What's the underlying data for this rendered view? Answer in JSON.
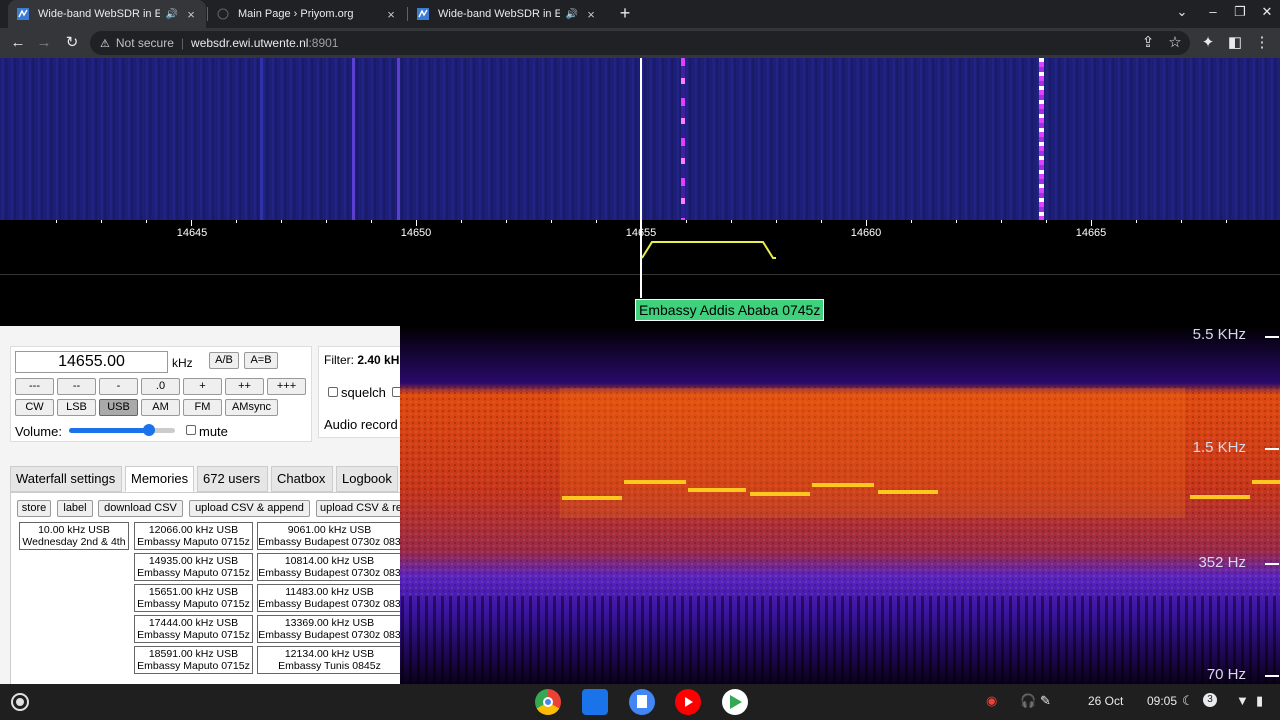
{
  "browser": {
    "tabs": [
      {
        "title": "Wide-band WebSDR in Ensch",
        "audio": true,
        "active": true
      },
      {
        "title": "Main Page › Priyom.org",
        "audio": false,
        "active": false
      },
      {
        "title": "Wide-band WebSDR in Ensch",
        "audio": true,
        "active": false
      }
    ],
    "new_tab": "+",
    "address": {
      "security": "Not secure",
      "host": "websdr.ewi.utwente.nl",
      "port": ":8901"
    }
  },
  "scale": {
    "ticks": [
      "14645",
      "14650",
      "14655",
      "14660",
      "14665"
    ]
  },
  "station_label": "Embassy Addis Ababa 0745z",
  "spectrogram": {
    "labels": [
      "5.5 KHz",
      "1.5 KHz",
      "352 Hz",
      "70 Hz"
    ]
  },
  "tuning": {
    "frequency": "14655.00",
    "unit": "kHz",
    "ab_buttons": [
      "A/B",
      "A=B"
    ],
    "step_buttons": [
      "---",
      "--",
      "-",
      ".0",
      "+",
      "++",
      "+++"
    ],
    "modes": [
      "CW",
      "LSB",
      "USB",
      "AM",
      "FM",
      "AMsync"
    ],
    "selected_mode": "USB",
    "volume_label": "Volume:",
    "volume_level": 0.75,
    "mute_label": "mute"
  },
  "filter": {
    "label": "Filter:",
    "value": "2.40 kH",
    "squelch_label": "squelch",
    "audio_label": "Audio record"
  },
  "panel_tabs": [
    "Waterfall settings",
    "Memories",
    "672 users",
    "Chatbox",
    "Logbook"
  ],
  "active_panel_tab": "Memories",
  "memories": {
    "buttons": [
      "store",
      "label",
      "download CSV",
      "upload CSV & append",
      "upload CSV & re"
    ],
    "columns": [
      [
        {
          "freq": "10.00 kHz USB",
          "name": "Wednesday 2nd & 4th"
        }
      ],
      [
        {
          "freq": "12066.00 kHz USB",
          "name": "Embassy Maputo 0715z"
        },
        {
          "freq": "14935.00 kHz USB",
          "name": "Embassy Maputo 0715z"
        },
        {
          "freq": "15651.00 kHz USB",
          "name": "Embassy Maputo 0715z"
        },
        {
          "freq": "17444.00 kHz USB",
          "name": "Embassy Maputo 0715z"
        },
        {
          "freq": "18591.00 kHz USB",
          "name": "Embassy Maputo 0715z"
        }
      ],
      [
        {
          "freq": "9061.00 kHz USB",
          "name": "Embassy Budapest 0730z 083"
        },
        {
          "freq": "10814.00 kHz USB",
          "name": "Embassy Budapest 0730z 083"
        },
        {
          "freq": "11483.00 kHz USB",
          "name": "Embassy Budapest 0730z 083"
        },
        {
          "freq": "13369.00 kHz USB",
          "name": "Embassy Budapest 0730z 083"
        },
        {
          "freq": "12134.00 kHz USB",
          "name": "Embassy Tunis 0845z"
        }
      ]
    ]
  },
  "shelf": {
    "date": "26 Oct",
    "time": "09:05",
    "notification_count": "3"
  }
}
